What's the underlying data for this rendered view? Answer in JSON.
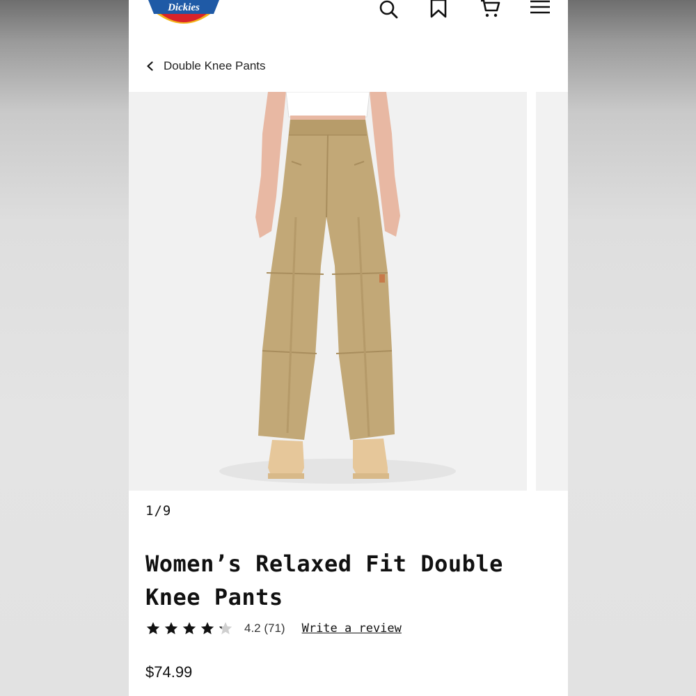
{
  "brand": {
    "name": "Dickies",
    "color_blue": "#1f5aa6",
    "color_red": "#d8232a",
    "color_yellow": "#f3b41b"
  },
  "header": {
    "icons": [
      "search-icon",
      "bookmark-icon",
      "cart-icon",
      "menu-icon"
    ]
  },
  "breadcrumb": {
    "label": "Double Knee Pants"
  },
  "gallery": {
    "counter": "1/9",
    "current": 1,
    "total": 9
  },
  "product": {
    "title": "Women’s Relaxed Fit Double Knee Pants",
    "rating_value": 4.2,
    "rating_text": "4.2 (71)",
    "review_link": "Write a review",
    "price": "$74.99"
  }
}
